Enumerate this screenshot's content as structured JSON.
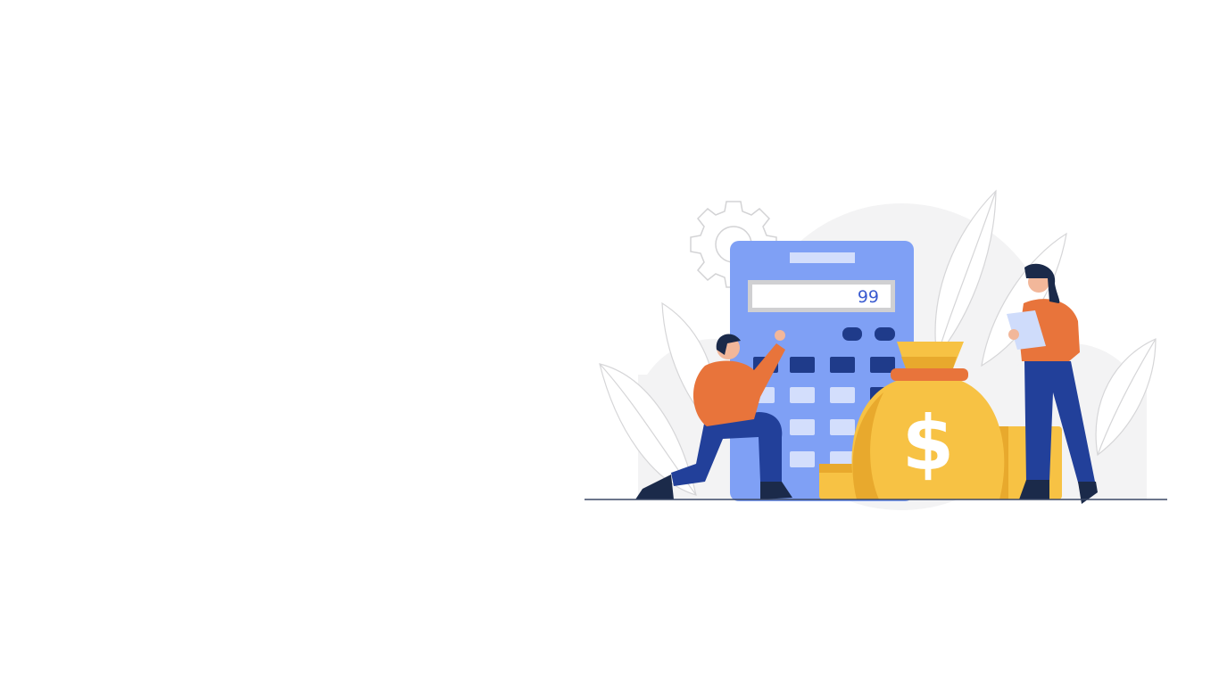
{
  "illustration": {
    "calculator_display": "99",
    "money_bag_symbol": "$",
    "icons": [
      "gear-icon",
      "calculator-icon",
      "money-bag-icon",
      "coin-stack-icon",
      "leaf-icon",
      "person-kneeling",
      "person-with-clipboard"
    ]
  },
  "colors": {
    "background": "#ffffff",
    "backdrop": "#f2f2f3",
    "calculator": "#7fa0f5",
    "calculator_light_key": "#d3defc",
    "calculator_dark_key": "#1f3b8a",
    "display_text": "#3a5bd0",
    "bag": "#f7c244",
    "bag_shade": "#e8a92d",
    "shirt": "#e8743b",
    "pants": "#22409a",
    "hair": "#1b2a4a",
    "ground": "#3b4866"
  }
}
